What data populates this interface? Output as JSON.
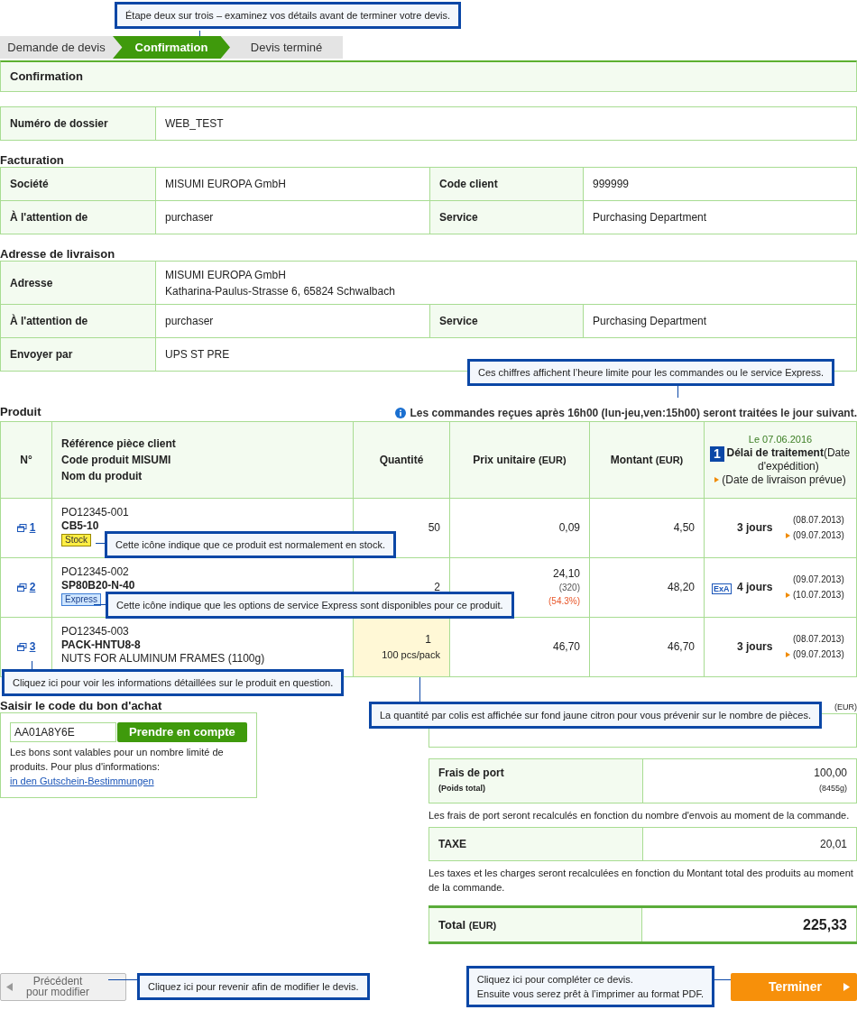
{
  "steps": [
    {
      "label": "Demande de devis",
      "selected": false
    },
    {
      "label": "Confirmation",
      "selected": true
    },
    {
      "label": "Devis terminé",
      "selected": false
    }
  ],
  "header": {
    "title": "Confirmation"
  },
  "dossier": {
    "label": "Numéro de dossier",
    "value": "WEB_TEST"
  },
  "billing": {
    "title": "Facturation",
    "rows": [
      [
        {
          "label": "Société",
          "value": "MISUMI EUROPA GmbH"
        },
        {
          "label": "Code client",
          "value": "999999"
        }
      ],
      [
        {
          "label": "À l'attention de",
          "value": "purchaser"
        },
        {
          "label": "Service",
          "value": "Purchasing Department"
        }
      ]
    ]
  },
  "delivery": {
    "title": "Adresse de livraison",
    "rows": [
      [
        {
          "label": "Adresse",
          "lines": [
            "MISUMI EUROPA GmbH",
            "Katharina-Paulus-Strasse 6, 65824 Schwalbach"
          ]
        }
      ],
      [
        {
          "label": "À l'attention de",
          "lines": [
            "purchaser"
          ]
        },
        {
          "label": "Service",
          "lines": [
            "Purchasing Department"
          ]
        }
      ],
      [
        {
          "label": "Envoyer par",
          "lines": [
            "UPS ST PRE"
          ]
        }
      ]
    ]
  },
  "products": {
    "title": "Produit",
    "notice": "Les commandes reçues après 16h00 (lun-jeu,ven:15h00) seront traitées le jour suivant.",
    "columns": {
      "number": "N°",
      "reference": [
        "Référence pièce client",
        "Code produit MISUMI",
        "Nom du produit"
      ],
      "quantity": "Quantité",
      "unit_price": "Prix unitaire",
      "unit_price_currency": "(EUR)",
      "amount": "Montant",
      "amount_currency": "(EUR)",
      "date": "Le 07.06.2016",
      "marker": "1",
      "lead_time": "Délai de traitement",
      "lead_time_note": "(Date d'expédition)",
      "delivery_note": "(Date de livraison prévue)"
    },
    "rows": [
      {
        "number": "1",
        "reference": "PO12345-001",
        "code": "CB5-10",
        "badge": {
          "kind": "stock",
          "label": "Stock"
        },
        "quantity": "50",
        "highlight": false,
        "unit_price": "0,09",
        "amount": "4,50",
        "days": "3 jours",
        "ship_date": "(08.07.2013)",
        "delivery_date": "(09.07.2013)"
      },
      {
        "number": "2",
        "reference": "PO12345-002",
        "code": "SP80B20-N-40",
        "badge": {
          "kind": "express",
          "label": "Express"
        },
        "quantity": "2",
        "highlight": false,
        "unit_price": "24,10",
        "base_price": "(320)",
        "discount": "(54.3%)",
        "amount": "48,20",
        "service_mark": "ExA",
        "days": "4 jours",
        "ship_date": "(09.07.2013)",
        "delivery_date": "(10.07.2013)"
      },
      {
        "number": "3",
        "reference": "PO12345-003",
        "code": "PACK-HNTU8-8",
        "name": "NUTS FOR ALUMINUM FRAMES (1100g)",
        "quantity": "1",
        "pack": "100 pcs/pack",
        "highlight": true,
        "unit_price": "46,70",
        "amount": "46,70",
        "days": "3 jours",
        "ship_date": "(08.07.2013)",
        "delivery_date": "(09.07.2013)"
      }
    ]
  },
  "coupon": {
    "title": "Saisir le code du bon d'achat",
    "value": "AA01A8Y6E",
    "button": "Prendre en compte",
    "note": "Les bons sont valables pour un nombre limité de produits. Pour plus d'informations:",
    "link": "in den Gutschein-Bestimmungen"
  },
  "summary": {
    "currency": "(EUR)",
    "shipping": {
      "label": "Frais de port",
      "sub": "(Poids total)",
      "value": "100,00",
      "weight": "(8455g)",
      "note": "Les frais de port seront recalculés en fonction du nombre d'envois au moment de la commande."
    },
    "tax": {
      "label": "TAXE",
      "value": "20,01",
      "note": "Les taxes et les charges seront recalculées en fonction du Montant total des produits au moment de la commande."
    },
    "total": {
      "label": "Total",
      "unit": "(EUR)",
      "value": "225,33"
    }
  },
  "buttons": {
    "back": "Précédent pour modifier",
    "finish": "Terminer"
  },
  "callouts": [
    {
      "lines": [
        "Étape deux sur trois – examinez vos détails avant de terminer votre devis."
      ]
    },
    {
      "lines": [
        "Ces chiffres affichent l’heure limite pour les commandes ou le service Express."
      ]
    },
    {
      "lines": [
        "Cette icône indique que ce produit est normalement en stock."
      ]
    },
    {
      "lines": [
        "Cette icône indique que les options de service Express sont disponibles pour ce produit."
      ]
    },
    {
      "lines": [
        "Cliquez ici pour voir les informations détaillées sur le produit en question."
      ]
    },
    {
      "lines": [
        "La quantité par colis est affichée sur fond jaune citron pour vous prévenir sur le nombre de pièces."
      ]
    },
    {
      "lines": [
        "Cliquez ici pour revenir afin de modifier le devis."
      ]
    },
    {
      "lines": [
        "Cliquez ici pour compléter ce devis.",
        "Ensuite vous serez prêt à l’imprimer au format PDF."
      ]
    }
  ]
}
